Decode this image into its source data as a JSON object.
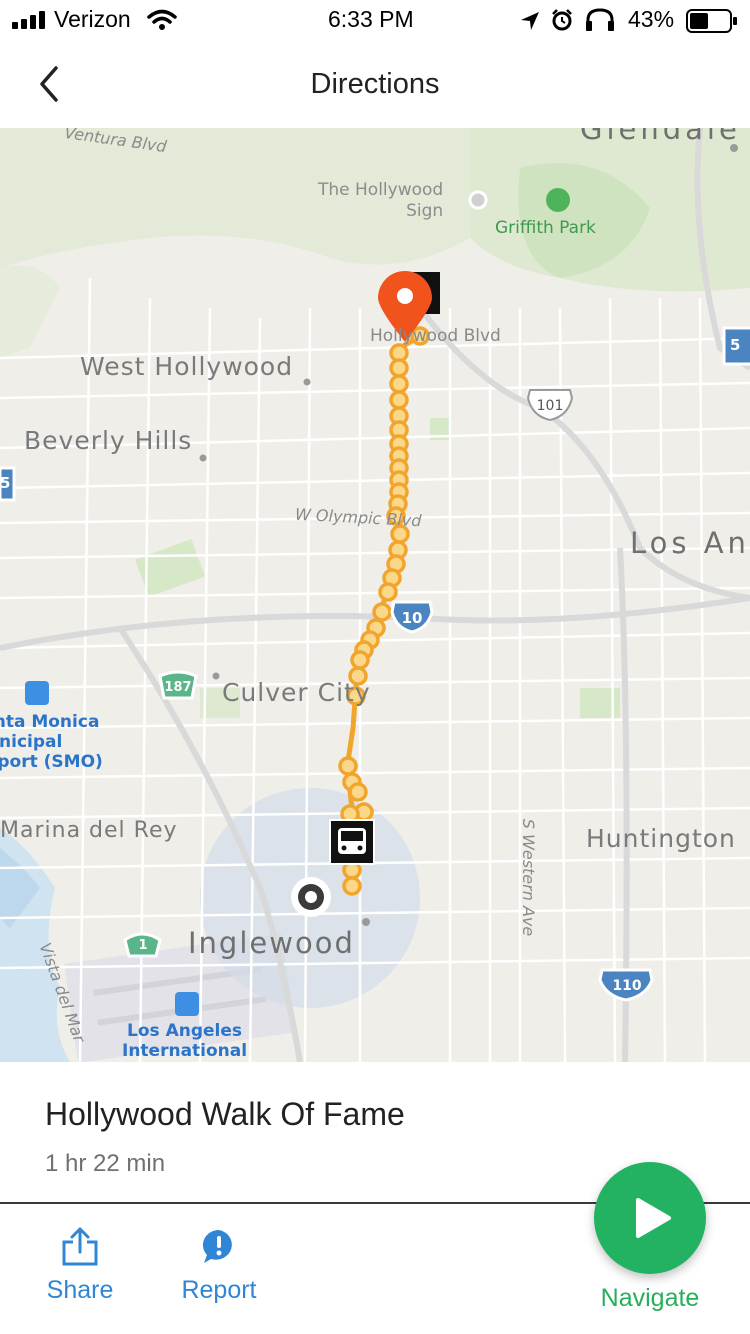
{
  "status": {
    "carrier": "Verizon",
    "time": "6:33 PM",
    "battery": "43%",
    "icons": [
      "signal-icon",
      "wifi-icon",
      "location-arrow-icon",
      "alarm-icon",
      "headphones-icon",
      "battery-icon"
    ]
  },
  "nav": {
    "title": "Directions",
    "back_icon": "chevron-left-icon"
  },
  "map": {
    "labels": {
      "ventura": "Ventura Blvd",
      "glendale": "Glendale",
      "hollywood_sign": "The Hollywood\nSign",
      "griffith": "Griffith Park",
      "hollywood_blvd": "Hollywood Blvd",
      "west_hollywood": "West Hollywood",
      "beverly_hills": "Beverly Hills",
      "olympic": "W Olympic Blvd",
      "los_angeles": "Los Angeles",
      "culver_city": "Culver City",
      "santa_monica_airport": "Santa Monica\nMunicipal\nAirport (SMO)",
      "marina": "Marina del Rey",
      "huntington": "Huntington",
      "western_ave": "S Western Ave",
      "inglewood": "Inglewood",
      "vista_del_mar": "Vista del Mar",
      "lax": "Los Angeles\nInternational"
    },
    "shields": {
      "us101": "101",
      "i10": "10",
      "i110": "110",
      "ca187": "187",
      "ca1": "1",
      "i5": "5"
    },
    "route_color": "#f2a52c",
    "pin_color": "#f0531c"
  },
  "destination": {
    "name": "Hollywood Walk Of Fame",
    "duration": "1 hr 22 min"
  },
  "toolbar": {
    "share_label": "Share",
    "report_label": "Report",
    "navigate_label": "Navigate",
    "accent": "#2f86d6",
    "navigate_color": "#22b262"
  }
}
